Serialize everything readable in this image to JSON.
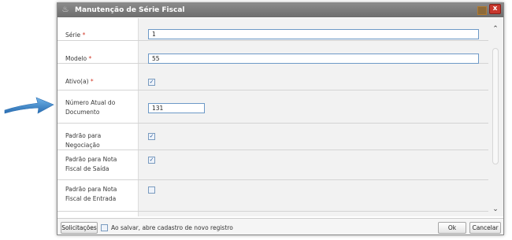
{
  "dialog": {
    "title": "Manutenção de Série Fiscal",
    "close_label": "x"
  },
  "fields": [
    {
      "label": "Série",
      "required_mark": "*",
      "value": "1"
    },
    {
      "label": "Modelo",
      "required_mark": "*",
      "value": "55"
    },
    {
      "label": "Ativo(a)",
      "required_mark": "*",
      "checked": true
    },
    {
      "label": "Número Atual do Documento",
      "value": "131"
    },
    {
      "label": "Padrão para Negociação",
      "checked": true
    },
    {
      "label": "Padrão para Nota Fiscal de Saída",
      "checked": true
    },
    {
      "label": "Padrão para Nota Fiscal de Entrada",
      "checked": false
    }
  ],
  "scroll": {
    "up_glyph": "⌃",
    "down_glyph": "⌄"
  },
  "check_glyph": "✓",
  "footer": {
    "requests_label": "Solicitações",
    "reopen_label": "Ao salvar, abre cadastro de novo registro",
    "reopen_checked": false,
    "ok_label": "Ok",
    "cancel_label": "Cancelar"
  },
  "colors": {
    "arrow": "#3d86c6",
    "required": "#d23a2a",
    "titlebar": "#7a7a7a",
    "input_border": "#6d99c7"
  }
}
